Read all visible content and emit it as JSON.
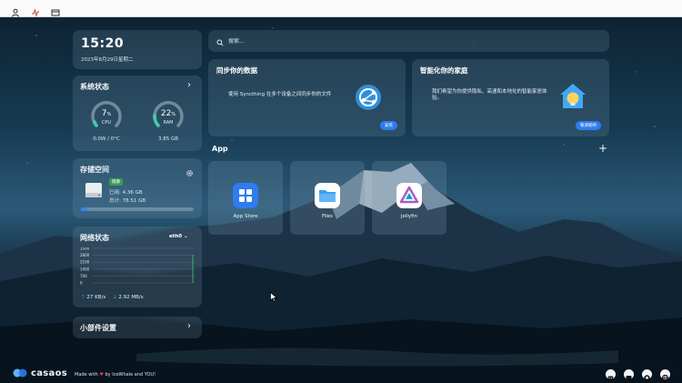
{
  "clock": {
    "time": "15:20",
    "date": "2023年8月29日星期二"
  },
  "system": {
    "title": "系统状态",
    "cpu": {
      "value": "7",
      "unit": "%",
      "label": "CPU",
      "percent": 7,
      "sub": "0.0W / 0°C"
    },
    "ram": {
      "value": "22",
      "unit": "%",
      "label": "RAM",
      "percent": 22,
      "sub": "3.85 GB"
    }
  },
  "storage": {
    "title": "存储空间",
    "health": "健康",
    "used": "已用: 4.36 GB",
    "total": "总计: 78.51 GB",
    "used_fraction": 0.055
  },
  "network": {
    "title": "网络状态",
    "interface": "eth0",
    "y_ticks": [
      "3500",
      "2800",
      "2100",
      "1400",
      "700",
      "0"
    ],
    "upload": "27 KB/s",
    "download": "2.92 MB/s"
  },
  "widget_settings": {
    "label": "小部件设置"
  },
  "search": {
    "placeholder": "搜索..."
  },
  "promos": [
    {
      "title": "同步你的数据",
      "desc": "使用 Syncthing 在多个设备之间同步你的文件",
      "button": "安装"
    },
    {
      "title": "智能化你的家庭",
      "desc": "我们希望为你提供隐私、高速和本地化的智能家居体验。",
      "button": "敬请期待"
    }
  ],
  "apps": {
    "heading": "App",
    "items": [
      {
        "label": "App Store",
        "icon": "app-store-icon",
        "color": "#2f7cf0"
      },
      {
        "label": "Files",
        "icon": "folder-icon",
        "color": "#3aa0f0"
      },
      {
        "label": "Jellyfin",
        "icon": "jellyfin-icon",
        "color": "#aa5cc3"
      }
    ]
  },
  "footer": {
    "logo": "casaos",
    "made_prefix": "Made with",
    "made_suffix": "by IceWhale and YOU!"
  }
}
